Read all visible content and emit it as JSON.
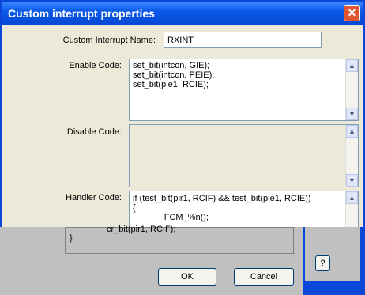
{
  "window": {
    "title": "Custom interrupt properties",
    "close_glyph": "✕"
  },
  "fields": {
    "name_label": "Custom Interrupt Name:",
    "name_value": "RXINT",
    "enable_label": "Enable Code:",
    "enable_code": "set_bit(intcon, GIE);\nset_bit(intcon, PEIE);\nset_bit(pie1, RCIE);",
    "disable_label": "Disable Code:",
    "disable_code": "",
    "handler_label": "Handler Code:",
    "handler_code": "if (test_bit(pir1, RCIF) && test_bit(pie1, RCIE))\n{\n             FCM_%n();"
  },
  "glitch": {
    "line1": "cr_bit(pir1, RCIF);",
    "line2": "}"
  },
  "buttons": {
    "ok": "OK",
    "cancel": "Cancel",
    "help": "?"
  }
}
